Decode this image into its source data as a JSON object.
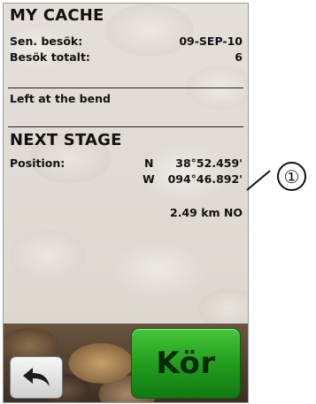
{
  "my_cache": {
    "title": "MY CACHE",
    "last_visit_label": "Sen. besök:",
    "last_visit_value": "09-SEP-10",
    "total_visits_label": "Besök totalt:",
    "total_visits_value": "6",
    "note": "Left at the bend"
  },
  "next_stage": {
    "title": "NEXT STAGE",
    "position_label": "Position:",
    "lat_hemisphere": "N",
    "lat_value": "38°52.459'",
    "lon_hemisphere": "W",
    "lon_value": "094°46.892'",
    "distance": "2.49 km NO"
  },
  "buttons": {
    "back_icon": "back-arrow-icon",
    "go_label": "Kör"
  },
  "callout": {
    "number": "①"
  },
  "colors": {
    "go_button": "#1f9a1c",
    "text": "#111111"
  }
}
